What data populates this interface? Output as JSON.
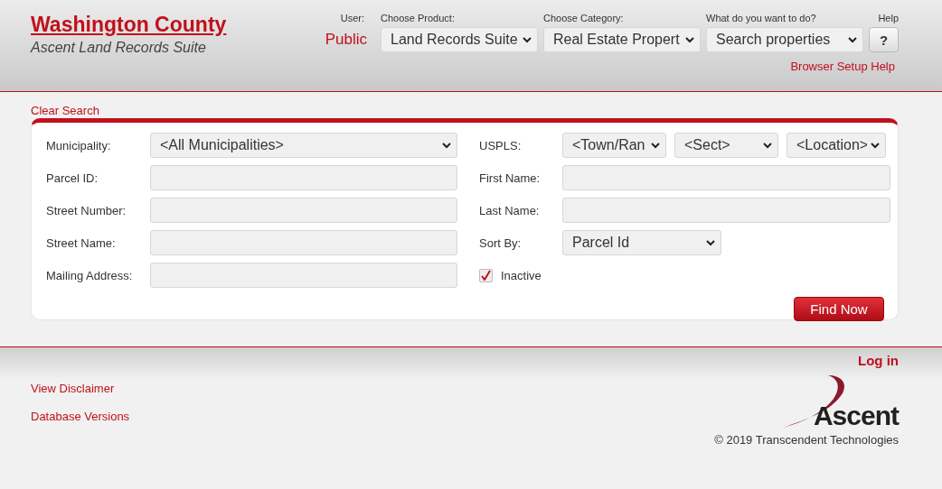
{
  "header": {
    "title": "Washington County",
    "subtitle": "Ascent Land Records Suite",
    "user": {
      "label": "User:",
      "value": "Public"
    },
    "selects": [
      {
        "label": "Choose Product:",
        "value": "Land Records Suite"
      },
      {
        "label": "Choose Category:",
        "value": "Real Estate Propert"
      },
      {
        "label": "What do you want to do?",
        "value": "Search properties"
      }
    ],
    "help": {
      "label": "Help",
      "button": "?"
    },
    "setup_link": "Browser Setup Help"
  },
  "search": {
    "clear_link": "Clear Search",
    "left_fields": [
      {
        "label": "Municipality:",
        "kind": "select",
        "value": "<All Municipalities>"
      },
      {
        "label": "Parcel ID:",
        "kind": "input"
      },
      {
        "label": "Street Number:",
        "kind": "input"
      },
      {
        "label": "Street Name:",
        "kind": "input"
      },
      {
        "label": "Mailing Address:",
        "kind": "input"
      }
    ],
    "uspls": {
      "label": "USPLS:",
      "selects": [
        "<Town/Ran",
        "<Sect>",
        "<Location>"
      ]
    },
    "right_fields": [
      {
        "label": "First Name:",
        "kind": "input"
      },
      {
        "label": "Last Name:",
        "kind": "input"
      },
      {
        "label": "Sort By:",
        "kind": "select",
        "value": "Parcel Id"
      }
    ],
    "inactive": {
      "label": "Inactive",
      "checked": true
    },
    "find_button": "Find Now"
  },
  "footer": {
    "login": "Log in",
    "links": [
      "View Disclaimer",
      "Database Versions"
    ],
    "logo": "Ascent",
    "copyright": "© 2019 Transcendent Technologies"
  }
}
